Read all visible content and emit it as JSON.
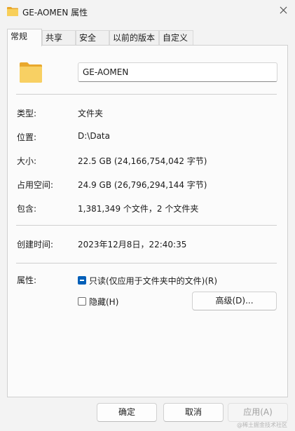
{
  "window": {
    "title": "GE-AOMEN 属性"
  },
  "tabs": [
    {
      "label": "常规",
      "active": true
    },
    {
      "label": "共享"
    },
    {
      "label": "安全"
    },
    {
      "label": "以前的版本"
    },
    {
      "label": "自定义"
    }
  ],
  "general": {
    "name_value": "GE-AOMEN",
    "type_label": "类型:",
    "type_value": "文件夹",
    "location_label": "位置:",
    "location_value": "D:\\Data",
    "size_label": "大小:",
    "size_value": "22.5 GB (24,166,754,042 字节)",
    "disk_size_label": "占用空间:",
    "disk_size_value": "24.9 GB (26,796,294,144 字节)",
    "contains_label": "包含:",
    "contains_value": "1,381,349 个文件，2 个文件夹",
    "created_label": "创建时间:",
    "created_value": "2023年12月8日，22:40:35",
    "attributes_label": "属性:",
    "readonly_label": "只读(仅应用于文件夹中的文件)(R)",
    "readonly_state": "indeterminate",
    "hidden_label": "隐藏(H)",
    "hidden_state": "unchecked",
    "advanced_label": "高级(D)..."
  },
  "buttons": {
    "ok": "确定",
    "cancel": "取消",
    "apply": "应用(A)"
  },
  "watermark": "@稀土掘金技术社区",
  "colors": {
    "accent": "#005fb8",
    "folder": "#f5c84c"
  },
  "icons": {
    "title": "folder-icon",
    "main": "folder-icon",
    "close": "close-icon"
  }
}
